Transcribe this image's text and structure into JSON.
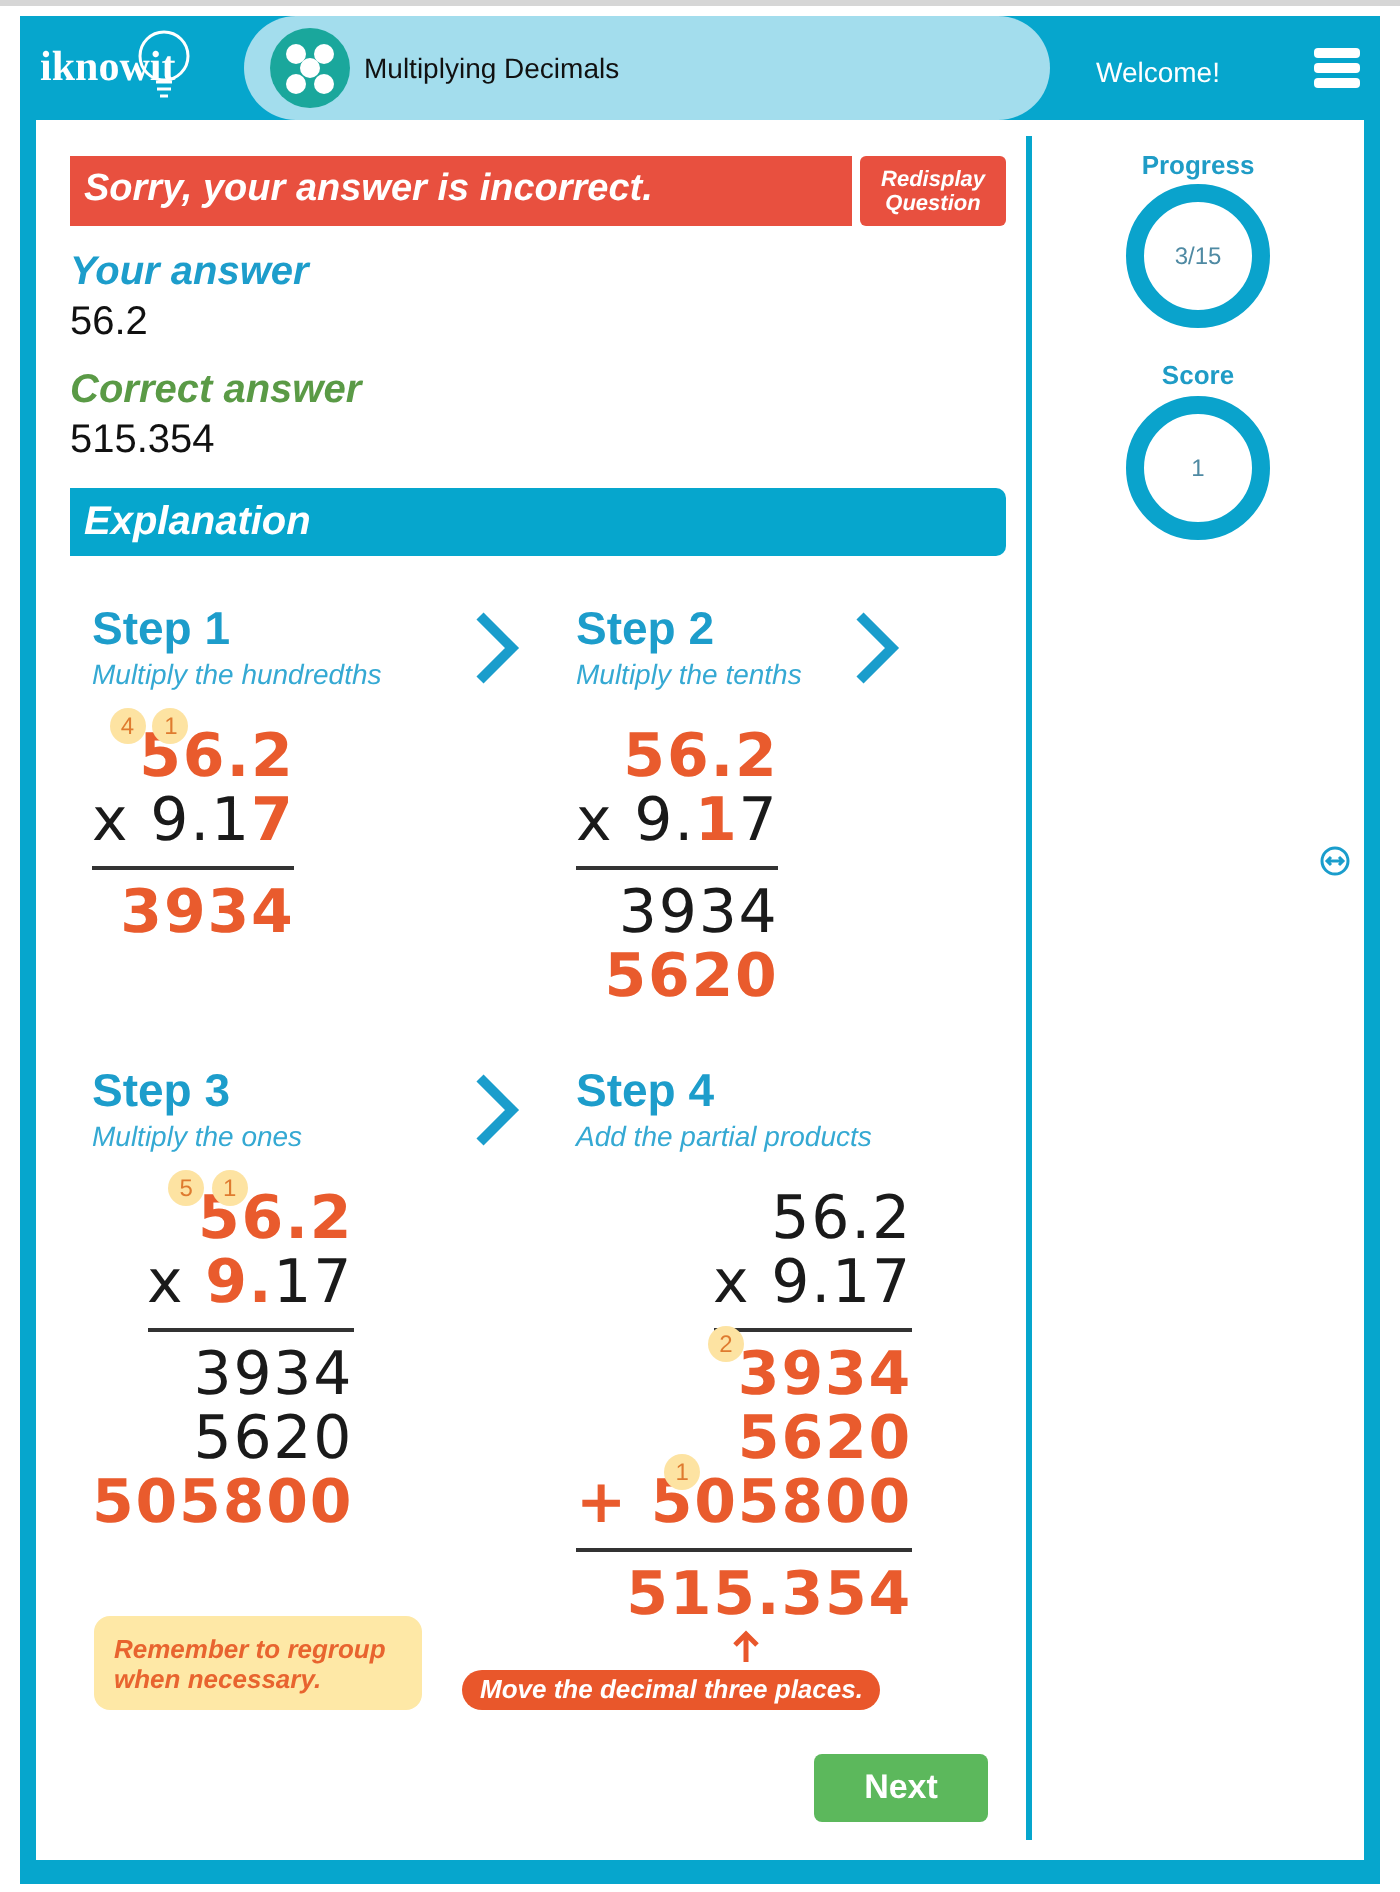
{
  "header": {
    "logo": "iknowit",
    "topic": "Multiplying Decimals",
    "greeting": "Welcome!"
  },
  "feedback": {
    "message": "Sorry, your answer is incorrect.",
    "button": "Redisplay Question"
  },
  "answers": [
    {
      "kind": "yours",
      "label": "Your answer",
      "value": "56.2"
    },
    {
      "kind": "correct",
      "label": "Correct answer",
      "value": "515.354"
    }
  ],
  "explanation": {
    "title": "Explanation",
    "steps": [
      {
        "title": "Step 1",
        "subtitle": "Multiply the hundredths",
        "arrow": true,
        "rows": [
          {
            "parts": [
              {
                "text": "5",
                "highlight": true,
                "carry": "4"
              },
              {
                "text": "6",
                "highlight": true,
                "carry": "1"
              },
              {
                "text": ".2",
                "highlight": true
              }
            ]
          },
          {
            "parts": [
              {
                "text": "x 9.1",
                "highlight": false
              },
              {
                "text": "7",
                "highlight": true
              }
            ],
            "underline": true
          },
          {
            "parts": [
              {
                "text": "3934",
                "highlight": true
              }
            ]
          }
        ]
      },
      {
        "title": "Step 2",
        "subtitle": "Multiply the tenths",
        "arrow": true,
        "rows": [
          {
            "parts": [
              {
                "text": "56.2",
                "highlight": true
              }
            ]
          },
          {
            "parts": [
              {
                "text": "x 9.",
                "highlight": false
              },
              {
                "text": "1",
                "highlight": true
              },
              {
                "text": "7",
                "highlight": false
              }
            ],
            "underline": true
          },
          {
            "parts": [
              {
                "text": "3934",
                "highlight": false
              }
            ]
          },
          {
            "parts": [
              {
                "text": "5620",
                "highlight": true
              }
            ]
          }
        ]
      },
      {
        "title": "Step 3",
        "subtitle": "Multiply the ones",
        "arrow": true,
        "rows": [
          {
            "parts": [
              {
                "text": "5",
                "highlight": true,
                "carry": "5"
              },
              {
                "text": "6",
                "highlight": true,
                "carry": "1"
              },
              {
                "text": ".2",
                "highlight": true
              }
            ]
          },
          {
            "parts": [
              {
                "text": "x ",
                "highlight": false
              },
              {
                "text": "9.",
                "highlight": true
              },
              {
                "text": "17",
                "highlight": false
              }
            ],
            "underline": true
          },
          {
            "parts": [
              {
                "text": "3934",
                "highlight": false
              }
            ]
          },
          {
            "parts": [
              {
                "text": "5620",
                "highlight": false
              }
            ]
          },
          {
            "parts": [
              {
                "text": "505800",
                "highlight": true
              }
            ]
          }
        ]
      },
      {
        "title": "Step 4",
        "subtitle": "Add the partial products",
        "arrow": false,
        "rows": [
          {
            "parts": [
              {
                "text": "56.2",
                "highlight": false
              }
            ]
          },
          {
            "parts": [
              {
                "text": "x 9.17",
                "highlight": false
              }
            ],
            "underline": true
          },
          {
            "parts": [
              {
                "text": "3934",
                "highlight": true,
                "carry": "2"
              }
            ]
          },
          {
            "parts": [
              {
                "text": "5620",
                "highlight": true
              }
            ]
          },
          {
            "parts": [
              {
                "text": "+ 5",
                "highlight": true
              },
              {
                "text": "05800",
                "highlight": true,
                "carry": "1"
              }
            ],
            "underline": true
          },
          {
            "parts": [
              {
                "text": "515.354",
                "highlight": true
              }
            ]
          }
        ]
      }
    ],
    "note": "Remember to regroup when necessary.",
    "callout": "Move the decimal three places."
  },
  "next_button": "Next",
  "sidebar": [
    {
      "label": "Progress",
      "value": "3/15"
    },
    {
      "label": "Score",
      "value": "1"
    }
  ]
}
